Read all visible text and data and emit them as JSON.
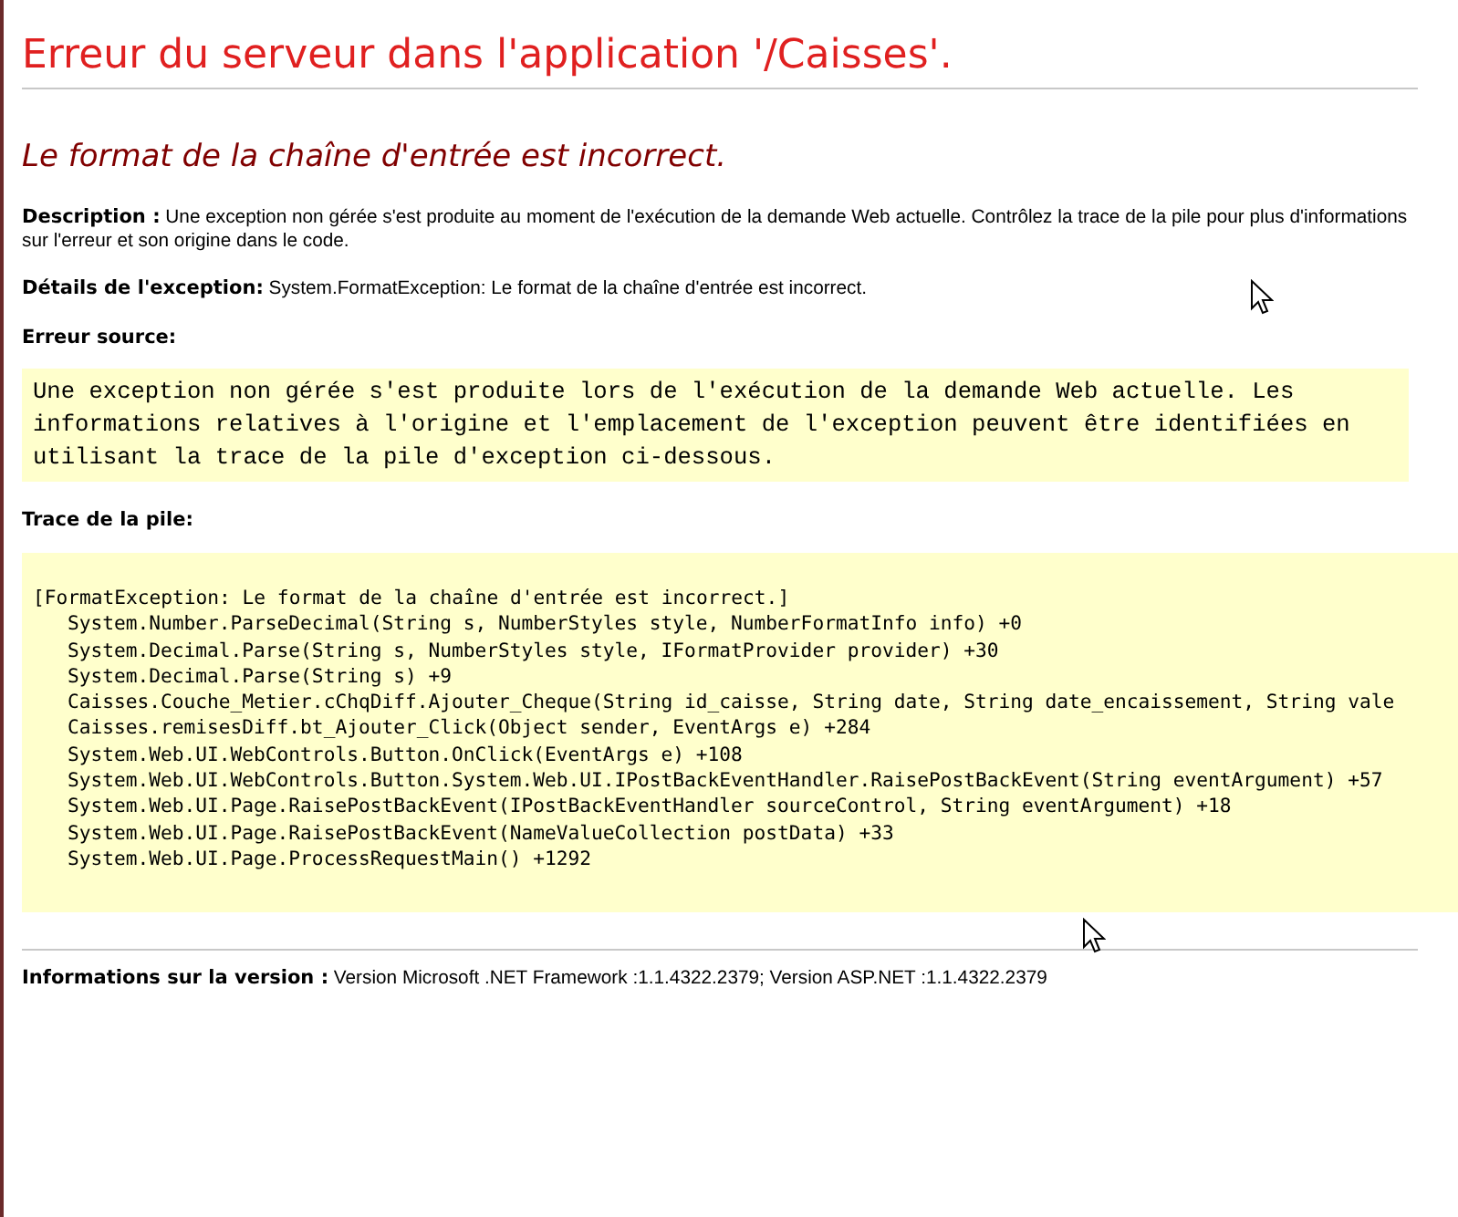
{
  "title": "Erreur du serveur dans l'application '/Caisses'.",
  "message": "Le format de la chaîne d'entrée est incorrect.",
  "description": "**Description :** Une exception non gérée s'est produite au moment de l'exécution de la demande Web actuelle. Contrôlez la trace de la pile pour plus d'informations sur l'erreur et son origine dans le code.",
  "details": "**Détails de l'exception:** System.FormatException: Le format de la chaîne d'entrée est incorrect.",
  "source": {
    "label": "Erreur source:",
    "lines": [
      "Une exception non gérée s'est produite lors de l'exécution de la demande Web actuelle. Les",
      "informations relatives à l'origine et l'emplacement de l'exception peuvent être identifiées en",
      "utilisant la trace de la pile d'exception ci-dessous."
    ]
  },
  "stack": {
    "label": "Trace de la pile:",
    "lines": [
      {
        "kind": "exception",
        "text": "[FormatException: Le format de la chaîne d'entrée est incorrect.]"
      },
      {
        "kind": "frame",
        "text": "System.Number.ParseDecimal(String s, NumberStyles style, NumberFormatInfo info) +0"
      },
      {
        "kind": "frame",
        "text": "System.Decimal.Parse(String s, NumberStyles style, IFormatProvider provider) +30"
      },
      {
        "kind": "frame",
        "text": "System.Decimal.Parse(String s) +9"
      },
      {
        "kind": "frame",
        "text": "Caisses.Couche_Metier.cChqDiff.Ajouter_Cheque(String id_caisse, String date, String date_encaissement, String vale"
      },
      {
        "kind": "frame",
        "text": "Caisses.remisesDiff.bt_Ajouter_Click(Object sender, EventArgs e) +284"
      },
      {
        "kind": "frame",
        "text": "System.Web.UI.WebControls.Button.OnClick(EventArgs e) +108"
      },
      {
        "kind": "frame",
        "text": "System.Web.UI.WebControls.Button.System.Web.UI.IPostBackEventHandler.RaisePostBackEvent(String eventArgument) +57"
      },
      {
        "kind": "frame",
        "text": "System.Web.UI.Page.RaisePostBackEvent(IPostBackEventHandler sourceControl, String eventArgument) +18"
      },
      {
        "kind": "frame",
        "text": "System.Web.UI.Page.RaisePostBackEvent(NameValueCollection postData) +33"
      },
      {
        "kind": "frame",
        "text": "System.Web.UI.Page.ProcessRequestMain() +1292"
      }
    ]
  },
  "version": "**Informations sur la version :** Version Microsoft .NET Framework :1.1.4322.2379; Version ASP.NET :1.1.4322.2379"
}
